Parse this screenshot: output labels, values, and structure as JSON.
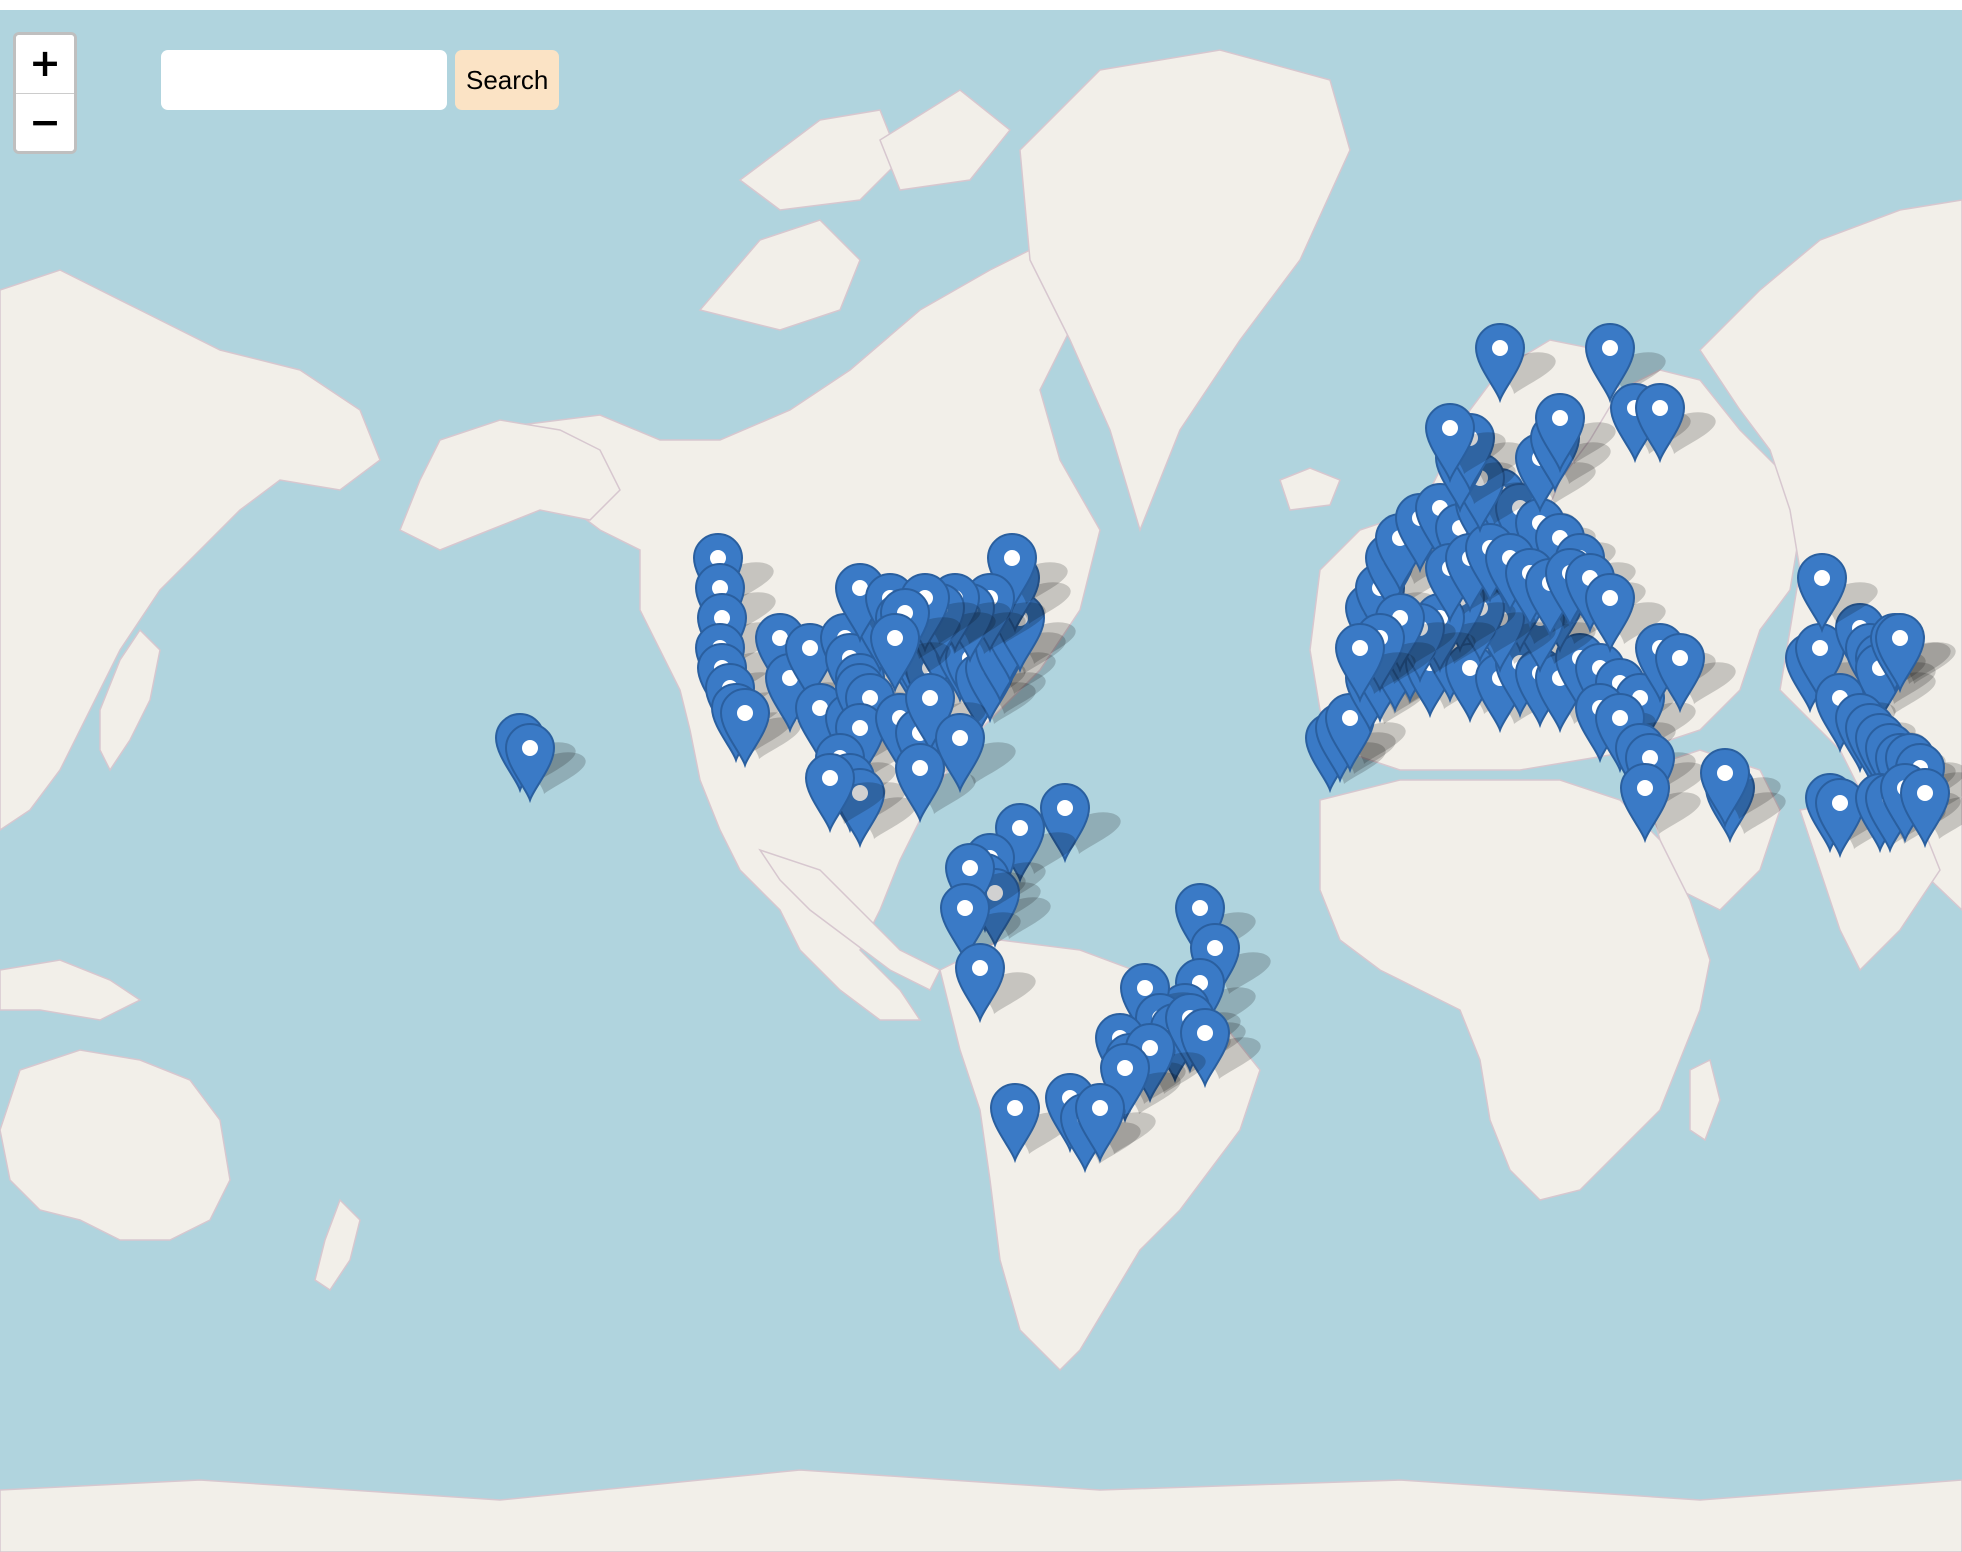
{
  "map": {
    "ocean_color": "#b0d4de",
    "land_color": "#f2efe9",
    "marker_color": "#3a7ac6",
    "marker_icon": "map-pin-icon"
  },
  "zoom": {
    "in_label": "+",
    "out_label": "−"
  },
  "search": {
    "placeholder": "",
    "value": "",
    "button_label": "Search"
  }
}
